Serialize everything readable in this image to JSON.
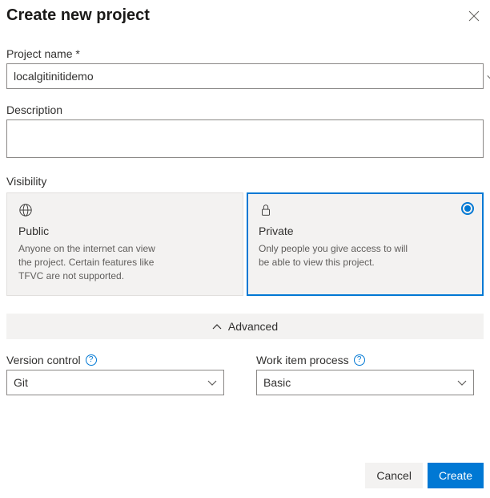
{
  "dialog": {
    "title": "Create new project"
  },
  "projectName": {
    "label": "Project name *",
    "value": "localgitinitidemo"
  },
  "description": {
    "label": "Description",
    "value": ""
  },
  "visibility": {
    "label": "Visibility",
    "public": {
      "title": "Public",
      "desc": "Anyone on the internet can view the project. Certain features like TFVC are not supported."
    },
    "private": {
      "title": "Private",
      "desc": "Only people you give access to will be able to view this project."
    },
    "selected": "private"
  },
  "advanced": {
    "toggleLabel": "Advanced",
    "versionControl": {
      "label": "Version control",
      "value": "Git"
    },
    "workItemProcess": {
      "label": "Work item process",
      "value": "Basic"
    }
  },
  "buttons": {
    "cancel": "Cancel",
    "create": "Create"
  }
}
